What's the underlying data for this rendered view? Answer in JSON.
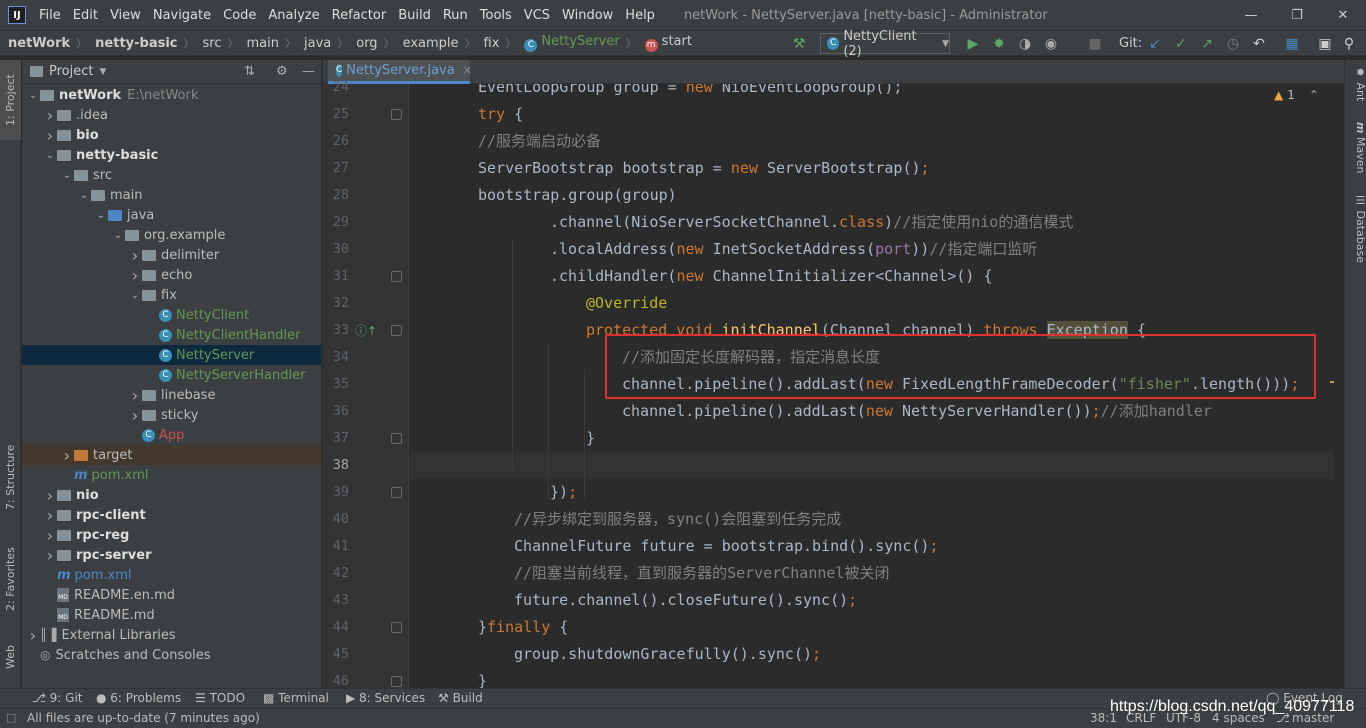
{
  "menubar": {
    "logo": "IJ",
    "items": [
      "File",
      "Edit",
      "View",
      "Navigate",
      "Code",
      "Analyze",
      "Refactor",
      "Build",
      "Run",
      "Tools",
      "VCS",
      "Window",
      "Help"
    ],
    "title": "netWork - NettyServer.java [netty-basic] - Administrator"
  },
  "navbar": {
    "crumbs": [
      "netWork",
      "netty-basic",
      "src",
      "main",
      "java",
      "org",
      "example",
      "fix",
      "NettyServer",
      "start"
    ],
    "run_config": "NettyClient (2)",
    "git_label": "Git:"
  },
  "left_stripe": {
    "project": "1: Project",
    "structure": "7: Structure",
    "favorites": "2: Favorites",
    "web": "Web"
  },
  "right_stripe": {
    "ant": "Ant",
    "maven": "Maven",
    "database": "Database"
  },
  "project_panel": {
    "title": "Project",
    "tree": [
      {
        "label": "netWork",
        "extra": "E:\\netWork",
        "depth": 0,
        "arrow": "open",
        "icon": "module-folder",
        "bold": true
      },
      {
        "label": ".idea",
        "depth": 1,
        "arrow": "closed",
        "icon": "folder"
      },
      {
        "label": "bio",
        "depth": 1,
        "arrow": "closed",
        "icon": "module-folder",
        "bold": true
      },
      {
        "label": "netty-basic",
        "depth": 1,
        "arrow": "open",
        "icon": "module-folder",
        "bold": true
      },
      {
        "label": "src",
        "depth": 2,
        "arrow": "open",
        "icon": "folder"
      },
      {
        "label": "main",
        "depth": 3,
        "arrow": "open",
        "icon": "folder"
      },
      {
        "label": "java",
        "depth": 4,
        "arrow": "open",
        "icon": "src-folder"
      },
      {
        "label": "org.example",
        "depth": 5,
        "arrow": "open",
        "icon": "folder"
      },
      {
        "label": "delimiter",
        "depth": 6,
        "arrow": "closed",
        "icon": "folder"
      },
      {
        "label": "echo",
        "depth": 6,
        "arrow": "closed",
        "icon": "folder"
      },
      {
        "label": "fix",
        "depth": 6,
        "arrow": "open",
        "icon": "folder"
      },
      {
        "label": "NettyClient",
        "depth": 7,
        "arrow": "none",
        "icon": "class",
        "color": "#629755"
      },
      {
        "label": "NettyClientHandler",
        "depth": 7,
        "arrow": "none",
        "icon": "class",
        "color": "#629755"
      },
      {
        "label": "NettyServer",
        "depth": 7,
        "arrow": "none",
        "icon": "class",
        "color": "#629755",
        "selected": true
      },
      {
        "label": "NettyServerHandler",
        "depth": 7,
        "arrow": "none",
        "icon": "class",
        "color": "#629755"
      },
      {
        "label": "linebase",
        "depth": 6,
        "arrow": "closed",
        "icon": "folder"
      },
      {
        "label": "sticky",
        "depth": 6,
        "arrow": "closed",
        "icon": "folder"
      },
      {
        "label": "App",
        "depth": 6,
        "arrow": "none",
        "icon": "class",
        "color": "#c75450"
      },
      {
        "label": "target",
        "depth": 2,
        "arrow": "closed",
        "icon": "orange-folder",
        "target": true
      },
      {
        "label": "pom.xml",
        "depth": 2,
        "arrow": "none",
        "icon": "maven",
        "color": "#629755"
      },
      {
        "label": "nio",
        "depth": 1,
        "arrow": "closed",
        "icon": "module-folder",
        "bold": true
      },
      {
        "label": "rpc-client",
        "depth": 1,
        "arrow": "closed",
        "icon": "module-folder",
        "bold": true
      },
      {
        "label": "rpc-reg",
        "depth": 1,
        "arrow": "closed",
        "icon": "module-folder",
        "bold": true
      },
      {
        "label": "rpc-server",
        "depth": 1,
        "arrow": "closed",
        "icon": "module-folder",
        "bold": true
      },
      {
        "label": "pom.xml",
        "depth": 1,
        "arrow": "none",
        "icon": "maven",
        "color": "#4a88c7"
      },
      {
        "label": "README.en.md",
        "depth": 1,
        "arrow": "none",
        "icon": "md"
      },
      {
        "label": "README.md",
        "depth": 1,
        "arrow": "none",
        "icon": "md"
      },
      {
        "label": "External Libraries",
        "depth": 0,
        "arrow": "closed",
        "icon": "library"
      },
      {
        "label": "Scratches and Consoles",
        "depth": 0,
        "arrow": "none",
        "icon": "scratch"
      }
    ]
  },
  "editor": {
    "tab_label": "NettyServer.java",
    "warning_count": "1",
    "current_line": 38,
    "lines": [
      {
        "n": "24",
        "indent": 0,
        "tokens": [
          [
            "EventLoopGroup group = ",
            "p"
          ],
          [
            "new ",
            "kw"
          ],
          [
            "NioEventLoopGroup();",
            "p"
          ]
        ]
      },
      {
        "n": "25",
        "indent": 0,
        "tokens": [
          [
            "try ",
            "kw"
          ],
          [
            "{",
            "p"
          ]
        ]
      },
      {
        "n": "26",
        "indent": 0,
        "tokens": [
          [
            "//服务端启动必备",
            "cm"
          ]
        ]
      },
      {
        "n": "27",
        "indent": 0,
        "tokens": [
          [
            "ServerBootstrap bootstrap = ",
            "p"
          ],
          [
            "new ",
            "kw"
          ],
          [
            "ServerBootstrap()",
            "p"
          ],
          [
            ";",
            "kw"
          ]
        ]
      },
      {
        "n": "28",
        "indent": 0,
        "tokens": [
          [
            "bootstrap.group(group)",
            "p"
          ]
        ]
      },
      {
        "n": "29",
        "indent": 2,
        "tokens": [
          [
            ".channel(NioServerSocketChannel.",
            "p"
          ],
          [
            "class",
            "kw"
          ],
          [
            ")",
            "p"
          ],
          [
            "//指定使用nio的通信模式",
            "cm"
          ]
        ]
      },
      {
        "n": "30",
        "indent": 2,
        "tokens": [
          [
            ".localAddress(",
            "p"
          ],
          [
            "new ",
            "kw"
          ],
          [
            "InetSocketAddress(",
            "p"
          ],
          [
            "port",
            "field"
          ],
          [
            "))",
            "p"
          ],
          [
            "//指定端口监听",
            "cm"
          ]
        ]
      },
      {
        "n": "31",
        "indent": 2,
        "tokens": [
          [
            ".childHandler(",
            "p"
          ],
          [
            "new ",
            "kw"
          ],
          [
            "ChannelInitializer<Channel>() {",
            "p"
          ]
        ]
      },
      {
        "n": "32",
        "indent": 3,
        "tokens": [
          [
            "@Override",
            "an"
          ]
        ]
      },
      {
        "n": "33",
        "indent": 3,
        "tokens": [
          [
            "protected void ",
            "kw"
          ],
          [
            "initChannel",
            "fn"
          ],
          [
            "(Channel channel) ",
            "p"
          ],
          [
            "throws ",
            "kw"
          ],
          [
            "Exception",
            "p"
          ],
          [
            " {",
            "p"
          ]
        ]
      },
      {
        "n": "34",
        "indent": 4,
        "tokens": [
          [
            "//添加固定长度解码器，指定消息长度",
            "cm"
          ]
        ]
      },
      {
        "n": "35",
        "indent": 4,
        "tokens": [
          [
            "channel.pipeline().addLast(",
            "p"
          ],
          [
            "new ",
            "kw"
          ],
          [
            "FixedLengthFrameDecoder(",
            "p"
          ],
          [
            "\"fisher\"",
            "str"
          ],
          [
            ".length()))",
            "p"
          ],
          [
            ";",
            "kw"
          ]
        ]
      },
      {
        "n": "36",
        "indent": 4,
        "tokens": [
          [
            "channel.pipeline().addLast(",
            "p"
          ],
          [
            "new ",
            "kw"
          ],
          [
            "NettyServerHandler())",
            "p"
          ],
          [
            ";",
            "kw"
          ],
          [
            "//添加handler",
            "cm"
          ]
        ]
      },
      {
        "n": "37",
        "indent": 3,
        "tokens": [
          [
            "}",
            "p"
          ]
        ]
      },
      {
        "n": "38",
        "indent": 0,
        "tokens": []
      },
      {
        "n": "39",
        "indent": 2,
        "tokens": [
          [
            "})",
            "p"
          ],
          [
            ";",
            "kw"
          ]
        ]
      },
      {
        "n": "40",
        "indent": 1,
        "tokens": [
          [
            "//异步绑定到服务器，sync()会阻塞到任务完成",
            "cm"
          ]
        ]
      },
      {
        "n": "41",
        "indent": 1,
        "tokens": [
          [
            "ChannelFuture future = bootstrap.bind().sync()",
            "p"
          ],
          [
            ";",
            "kw"
          ]
        ]
      },
      {
        "n": "42",
        "indent": 1,
        "tokens": [
          [
            "//阻塞当前线程，直到服务器的ServerChannel被关闭",
            "cm"
          ]
        ]
      },
      {
        "n": "43",
        "indent": 1,
        "tokens": [
          [
            "future.channel().closeFuture().sync()",
            "p"
          ],
          [
            ";",
            "kw"
          ]
        ]
      },
      {
        "n": "44",
        "indent": 0,
        "tokens": [
          [
            "}",
            "p"
          ],
          [
            "finally ",
            "kw"
          ],
          [
            "{",
            "p"
          ]
        ]
      },
      {
        "n": "45",
        "indent": 1,
        "tokens": [
          [
            "group.shutdownGracefully().sync()",
            "p"
          ],
          [
            ";",
            "kw"
          ]
        ]
      },
      {
        "n": "46",
        "indent": 0,
        "tokens": [
          [
            "}",
            "p"
          ]
        ]
      }
    ]
  },
  "bottom_tools": {
    "git": "9: Git",
    "problems": "6: Problems",
    "todo": "TODO",
    "terminal": "Terminal",
    "services": "8: Services",
    "build": "Build",
    "event_log": "Event Log"
  },
  "statusbar": {
    "message": "All files are up-to-date (7 minutes ago)",
    "position": "38:1",
    "line_sep": "CRLF",
    "encoding": "UTF-8",
    "indent": "4 spaces",
    "branch": "master"
  },
  "watermark": "https://blog.csdn.net/qq_40977118",
  "colors": {
    "keyword": "#cc7832",
    "comment": "#808080",
    "string": "#6a8759",
    "annotation": "#bbb529",
    "method": "#ffc66d",
    "field": "#9876aa",
    "highlight_box": "#e03030"
  }
}
